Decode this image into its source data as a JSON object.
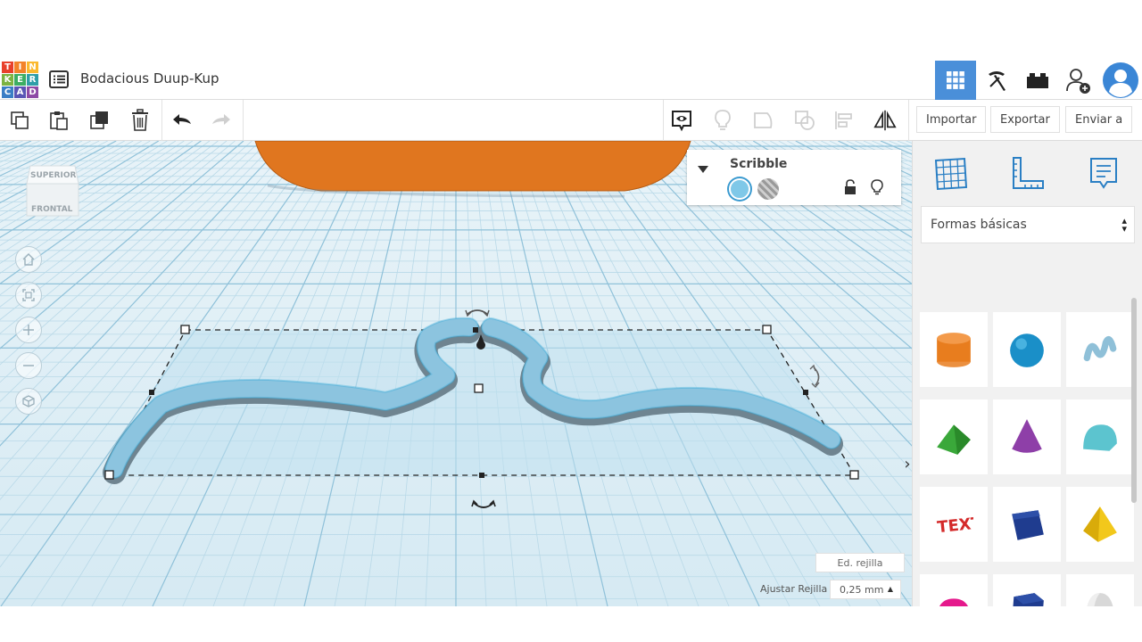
{
  "app": {
    "logo_letters": [
      "T",
      "I",
      "N",
      "K",
      "E",
      "R",
      "C",
      "A",
      "D"
    ],
    "logo_colors": [
      "#e8412c",
      "#f3832a",
      "#fbb92f",
      "#7cb342",
      "#3cae63",
      "#2f9ea8",
      "#3a7ec5",
      "#5a55b5",
      "#8e4aa6"
    ],
    "title": "Bodacious Duup-Kup"
  },
  "topbar": {
    "icons": [
      "grid-view-icon",
      "pickaxe-icon",
      "brick-icon",
      "add-user-icon",
      "avatar-icon"
    ],
    "active_color": "#4a8fd9"
  },
  "toolbar": {
    "import_label": "Importar",
    "export_label": "Exportar",
    "send_label": "Enviar a"
  },
  "viewcube": {
    "top_label": "SUPERIOR",
    "front_label": "FRONTAL"
  },
  "inspector": {
    "shape_name": "Scribble",
    "solid_color": "#7fc8e8"
  },
  "grid": {
    "edit_label": "Ed. rejilla",
    "snap_label": "Ajustar Rejilla",
    "snap_value": "0,25 mm"
  },
  "panel": {
    "category": "Formas básicas",
    "shapes": [
      {
        "name": "cylinder",
        "color": "#e87d1e"
      },
      {
        "name": "sphere",
        "color": "#1a8fc8"
      },
      {
        "name": "scribble",
        "color": "#8fc0d8"
      },
      {
        "name": "roof",
        "color": "#3aa83a"
      },
      {
        "name": "cone",
        "color": "#8e3fa8"
      },
      {
        "name": "round-roof",
        "color": "#5cc4cf"
      },
      {
        "name": "text",
        "color": "#d42a2a"
      },
      {
        "name": "box",
        "color": "#1f3c8f"
      },
      {
        "name": "pyramid",
        "color": "#f2c81b"
      },
      {
        "name": "half-sphere",
        "color": "#e5198c"
      },
      {
        "name": "polygon",
        "color": "#1f3c8f"
      },
      {
        "name": "paraboloid",
        "color": "#d8d8d8"
      }
    ]
  },
  "scene": {
    "selected_color": "#8cc4df",
    "orange_object_color": "#e0761f"
  }
}
